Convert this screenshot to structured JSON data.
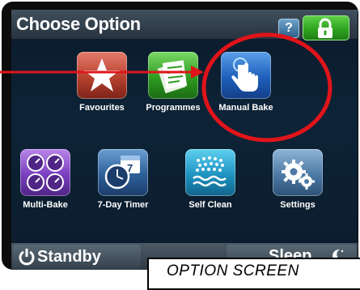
{
  "header": {
    "title": "Choose Option",
    "help_label": "?"
  },
  "tiles": [
    {
      "label": "Favourites",
      "icon": "star-icon",
      "color": "#b8412f"
    },
    {
      "label": "Programmes",
      "icon": "recipe-pages-icon",
      "color": "#2f9c22"
    },
    {
      "label": "Manual Bake",
      "icon": "hand-touch-icon",
      "color": "#1e5fbb"
    },
    {
      "label": "Multi-Bake",
      "icon": "four-gauges-icon",
      "color": "#7a3fbf"
    },
    {
      "label": "7-Day Timer",
      "icon": "clock-calendar-icon",
      "color": "#2e5f98"
    },
    {
      "label": "Self Clean",
      "icon": "steam-clean-icon",
      "color": "#1e93c2"
    },
    {
      "label": "Settings",
      "icon": "gears-icon",
      "color": "#4d7aa6"
    }
  ],
  "footer": {
    "standby_label": "Standby",
    "sleep_label": "Sleep"
  },
  "callout": {
    "text": "OPTION SCREEN",
    "ring_color": "#e0141a",
    "arrow_color": "#e0141a"
  }
}
